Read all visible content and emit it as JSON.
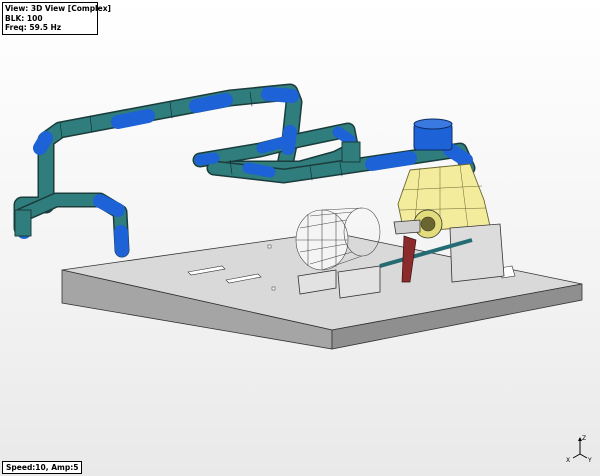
{
  "info": {
    "view_label": "View: 3D View [Complex]",
    "block_label": "BLK: 100",
    "freq_label": "Freq: 59.5 Hz"
  },
  "status": {
    "animation_label": "Speed:10, Amp:5"
  },
  "triad": {
    "z_label": "Z",
    "x_label": "X",
    "y_label": "Y"
  },
  "colors": {
    "pipe_teal": "#2f7d7c",
    "pipe_blue": "#1d62d6",
    "pump_yellow": "#f2ec9c",
    "baseplate_top": "#d6d6d6",
    "baseplate_side": "#9e9e9e",
    "wire_motor": "#555555",
    "shaft": "#246b73"
  }
}
